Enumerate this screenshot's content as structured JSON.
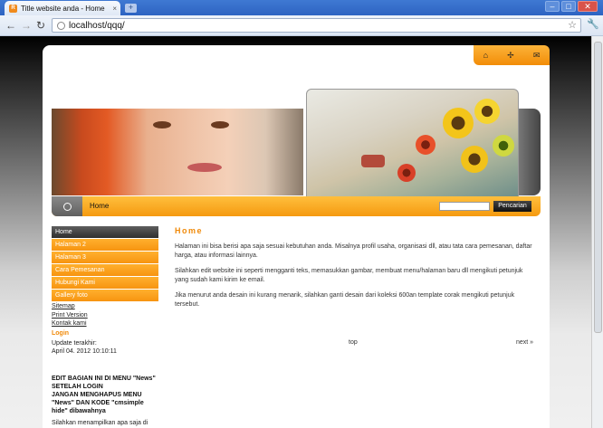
{
  "browser": {
    "tab_title": "Title website anda - Home",
    "tab_close": "×",
    "new_tab": "+",
    "favicon": "R",
    "window_min": "–",
    "window_max": "□",
    "window_close": "✕",
    "back": "←",
    "forward": "→",
    "reload": "↻",
    "url": "localhost/qqq/",
    "star": "☆",
    "wrench": "🔧"
  },
  "site": {
    "top_icons": {
      "home": "⌂",
      "sitemap": "✢",
      "mail": "✉"
    },
    "nav": {
      "home_label": "Home"
    },
    "search": {
      "button_label": "Pencarian",
      "placeholder": ""
    },
    "sidebar": {
      "menu": [
        "Home",
        "Halaman 2",
        "Halaman 3",
        "Cara Pemesanan",
        "Hubungi Kami",
        "Gallery foto"
      ],
      "links": [
        "Sitemap",
        "Print Version",
        "Kontak kami"
      ],
      "login": "Login",
      "update_label": "Update terakhir:",
      "update_date": "April 04. 2012 10:10:11",
      "news_lines": [
        "EDIT BAGIAN INI DI MENU \"News\"",
        "SETELAH LOGIN",
        "JANGAN MENGHAPUS MENU",
        "\"News\" DAN KODE \"cmsimple",
        "hide\" dibawahnya"
      ],
      "news_text": "Silahkan menampilkan apa saja di"
    },
    "content": {
      "title": "Home",
      "paragraphs": [
        "Halaman ini bisa berisi apa saja sesuai kebutuhan anda. Misalnya profil usaha, organisasi dll, atau tata cara pemesanan, daftar harga, atau informasi lainnya.",
        "Silahkan edit website ini seperti mengganti teks, memasukkan gambar, membuat menu/halaman baru dll mengikuti petunjuk yang sudah kami kirim ke email.",
        "Jika menurut anda desain ini kurang menarik, silahkan ganti desain dari koleksi 600an template corak mengikuti petunjuk tersebut."
      ],
      "top_link": "top",
      "next_link": "next »"
    }
  }
}
